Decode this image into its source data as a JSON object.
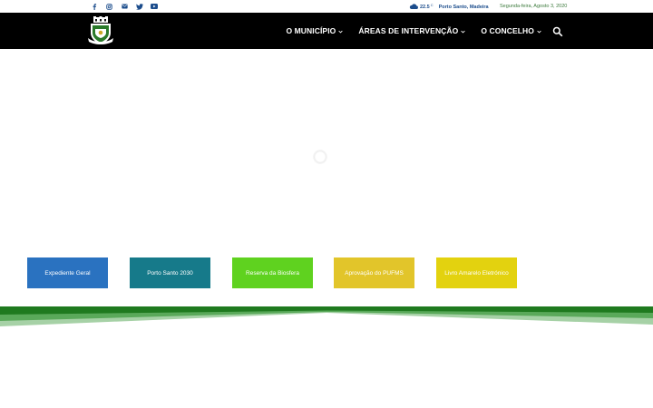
{
  "topbar": {
    "social": [
      {
        "name": "facebook-icon"
      },
      {
        "name": "instagram-icon"
      },
      {
        "name": "mail-icon"
      },
      {
        "name": "twitter-icon"
      },
      {
        "name": "youtube-icon"
      }
    ],
    "weather": {
      "icon": "cloud-icon",
      "temperature": "22.5",
      "unit": "C",
      "location": "Porto Santo, Madeira"
    },
    "date": "Segunda-feira, Agosto 3, 2020"
  },
  "header": {
    "logo": "municipal-coat-of-arms",
    "nav": [
      {
        "label": "O MUNICÍPIO"
      },
      {
        "label": "ÁREAS DE INTERVENÇÃO"
      },
      {
        "label": "O CONCELHO"
      }
    ],
    "search_icon": "search-icon"
  },
  "quick_links": [
    {
      "label": "Expediente Geral",
      "color": "#2a72c0"
    },
    {
      "label": "Porto Santo 2030",
      "color": "#167a8a"
    },
    {
      "label": "Reserva da Biosfera",
      "color": "#5fd21f"
    },
    {
      "label": "Aprovação do PUFMS",
      "color": "#e2c52a"
    },
    {
      "label": "Livro Amarelo Eletrónico",
      "color": "#e3d20f"
    }
  ],
  "colors": {
    "header_bg": "#000000",
    "wave_dark": "#1f7a1f",
    "wave_mid": "#5aa95a",
    "wave_light": "#a6d1a6"
  }
}
